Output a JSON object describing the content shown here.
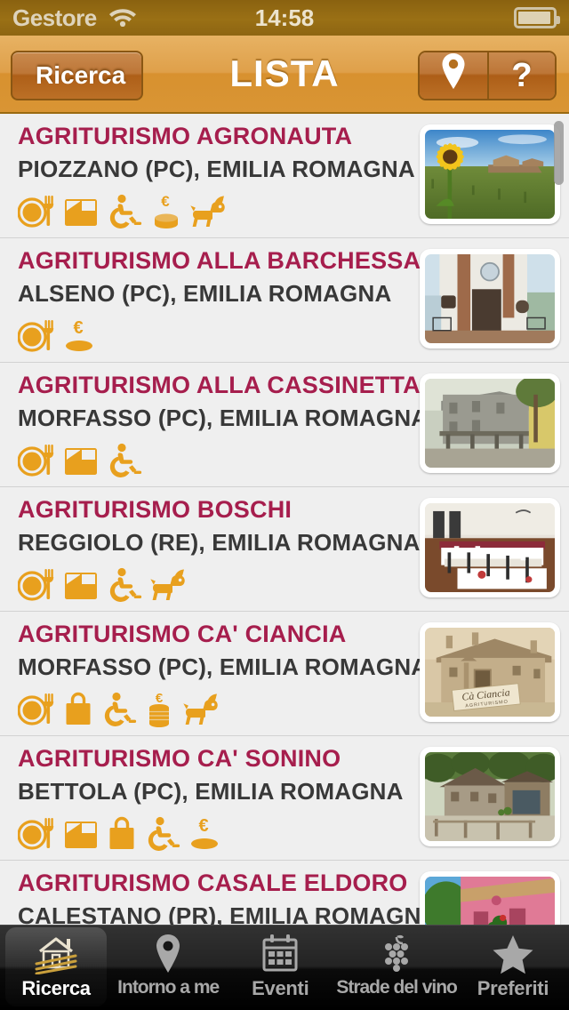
{
  "status_bar": {
    "carrier": "Gestore",
    "time": "14:58",
    "wifi_icon": "wifi-icon",
    "battery_icon": "battery-icon"
  },
  "nav_bar": {
    "back_label": "Ricerca",
    "title": "LISTA",
    "map_button_icon": "map-pin-icon",
    "help_button_label": "?"
  },
  "theme": {
    "title_color": "#a61e4d",
    "subtitle_color": "#383838",
    "icon_color": "#e8a01e",
    "navbar_color": "#dfa04a",
    "list_bg": "#efefef"
  },
  "list": {
    "rows": [
      {
        "title": "AGRITURISMO AGRONAUTA",
        "location": "PIOZZANO (PC), EMILIA ROMAGNA",
        "icons": [
          "restaurant-icon",
          "bed-icon",
          "wheelchair-icon",
          "euro-coins-icon",
          "pet-friendly-icon"
        ],
        "thumbnail": "sunflower-vineyard-photo"
      },
      {
        "title": "AGRITURISMO ALLA BARCHESSA",
        "location": "ALSENO (PC), EMILIA ROMAGNA",
        "icons": [
          "restaurant-icon",
          "euro-coin-icon"
        ],
        "thumbnail": "white-farmhouse-photo"
      },
      {
        "title": "AGRITURISMO ALLA CASSINETTA",
        "location": "MORFASSO (PC), EMILIA ROMAGNA",
        "icons": [
          "restaurant-icon",
          "bed-icon",
          "wheelchair-icon"
        ],
        "thumbnail": "stone-house-photo"
      },
      {
        "title": "AGRITURISMO BOSCHI",
        "location": "REGGIOLO (RE), EMILIA ROMAGNA",
        "icons": [
          "restaurant-icon",
          "bed-icon",
          "wheelchair-icon",
          "pet-friendly-icon"
        ],
        "thumbnail": "dining-hall-photo"
      },
      {
        "title": "AGRITURISMO CA' CIANCIA",
        "location": "MORFASSO (PC), EMILIA ROMAGNA",
        "icons": [
          "restaurant-icon",
          "shop-bag-icon",
          "wheelchair-icon",
          "euro-coins-tall-icon",
          "pet-friendly-icon"
        ],
        "thumbnail": "sepia-stone-villa-photo"
      },
      {
        "title": "AGRITURISMO CA' SONINO",
        "location": "BETTOLA (PC), EMILIA ROMAGNA",
        "icons": [
          "restaurant-icon",
          "bed-icon",
          "shop-bag-icon",
          "wheelchair-icon",
          "euro-coin-icon"
        ],
        "thumbnail": "mountain-stone-house-photo"
      },
      {
        "title": "AGRITURISMO CASALE ELDORO",
        "location": "CALESTANO (PR), EMILIA ROMAGNA",
        "icons": [],
        "thumbnail": "pink-house-photo"
      }
    ]
  },
  "tab_bar": {
    "tabs": [
      {
        "label": "Ricerca",
        "icon": "farmhouse-icon",
        "selected": true
      },
      {
        "label": "Intorno a me",
        "icon": "map-pin-icon",
        "selected": false
      },
      {
        "label": "Eventi",
        "icon": "calendar-icon",
        "selected": false
      },
      {
        "label": "Strade del vino",
        "icon": "grapes-icon",
        "selected": false
      },
      {
        "label": "Preferiti",
        "icon": "star-icon",
        "selected": false
      }
    ]
  }
}
